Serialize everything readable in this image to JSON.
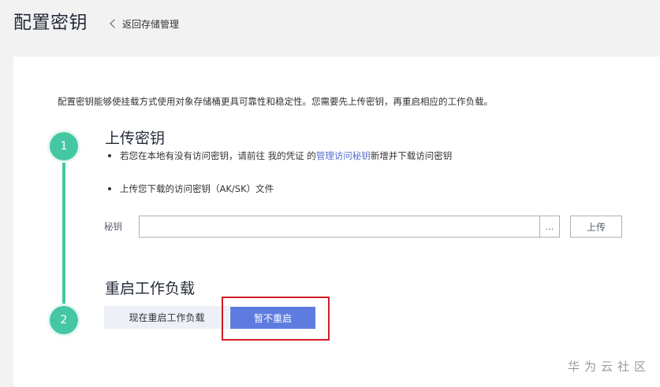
{
  "header": {
    "title": "配置密钥",
    "back_label": "返回存储管理"
  },
  "description": "配置密钥能够使挂载方式使用对象存储桶更具可靠性和稳定性。您需要先上传密钥，再重启相应的工作负载。",
  "steps": [
    {
      "number": "1",
      "title": "上传密钥",
      "bullets": {
        "first_prefix": "若您在本地有没有访问密钥，请前往 我的凭证 的 ",
        "first_link": "管理访问秘钥",
        "first_suffix": " 新增并下载访问密钥",
        "second": "上传您下载的访问密钥（AK/SK）文件"
      },
      "key_label": "秘钥",
      "key_value": "",
      "browse_label": "...",
      "upload_label": "上传"
    },
    {
      "number": "2",
      "title": "重启工作负载",
      "restart_now_label": "现在重启工作负载",
      "skip_label": "暂不重启"
    }
  ],
  "watermark": "华为云社区",
  "colors": {
    "accent_step": "#45c7a3",
    "primary_button": "#5e7ce0",
    "link": "#526ecc",
    "highlight_border": "#cf1d25"
  }
}
